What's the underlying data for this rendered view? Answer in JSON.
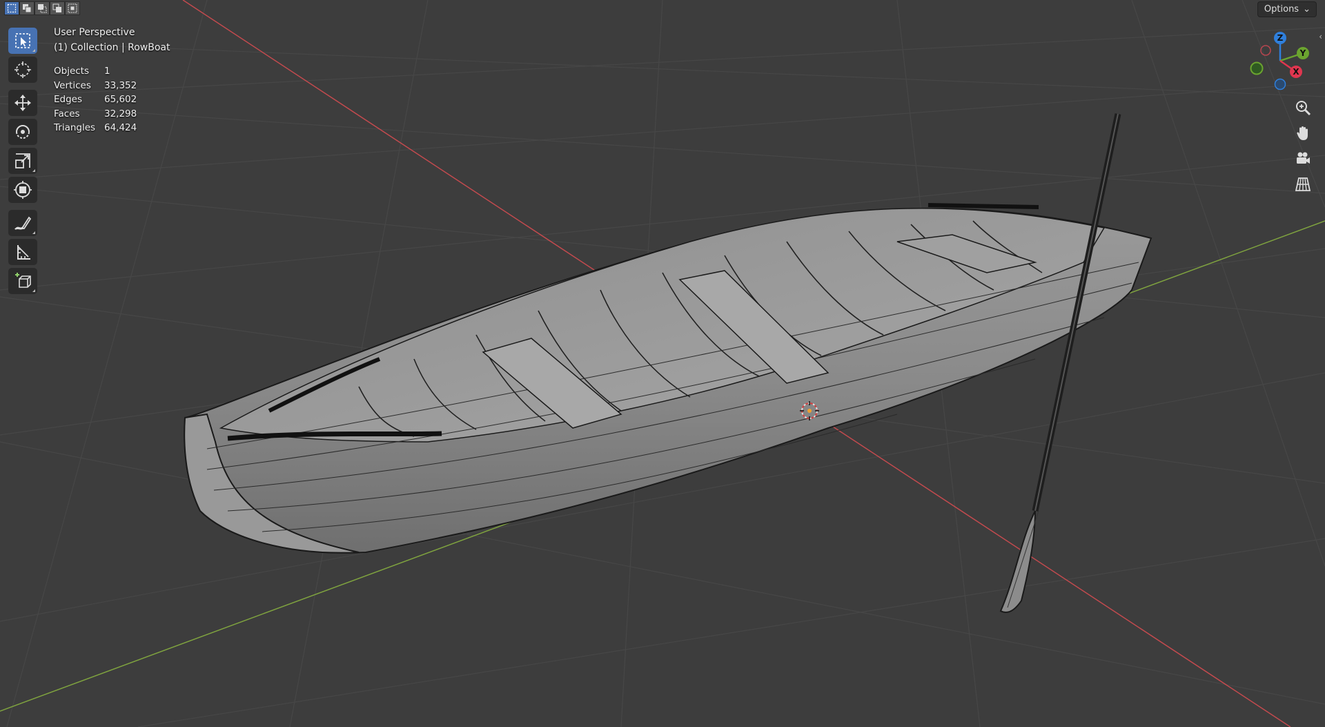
{
  "header": {
    "select_modes": [
      "select-new",
      "select-extend",
      "select-subtract",
      "select-invert",
      "select-intersect"
    ],
    "options_label": "Options"
  },
  "toolbar": {
    "tools": [
      "select-box-icon",
      "cursor-icon",
      "move-icon",
      "rotate-icon",
      "scale-icon",
      "transform-icon",
      "annotate-icon",
      "measure-icon",
      "add-cube-icon"
    ]
  },
  "viewport": {
    "view_name": "User Perspective",
    "collection_line": "(1) Collection | RowBoat"
  },
  "stats": {
    "rows": [
      {
        "label": "Objects",
        "value": "1"
      },
      {
        "label": "Vertices",
        "value": "33,352"
      },
      {
        "label": "Edges",
        "value": "65,602"
      },
      {
        "label": "Faces",
        "value": "32,298"
      },
      {
        "label": "Triangles",
        "value": "64,424"
      }
    ]
  },
  "gizmo": {
    "axis_z": "Z",
    "axis_y": "Y",
    "axis_x": "X",
    "colors": {
      "x": "#e0364f",
      "y": "#6ba42f",
      "z": "#2f7fdc"
    }
  },
  "nav": {
    "buttons": [
      "zoom-icon",
      "pan-hand-icon",
      "camera-icon",
      "grid-perspective-icon"
    ]
  },
  "colors": {
    "background": "#3d3d3d",
    "active_tool": "#4772b3",
    "x_axis_line": "#c24a4e",
    "y_axis_line": "#7fa33f"
  }
}
